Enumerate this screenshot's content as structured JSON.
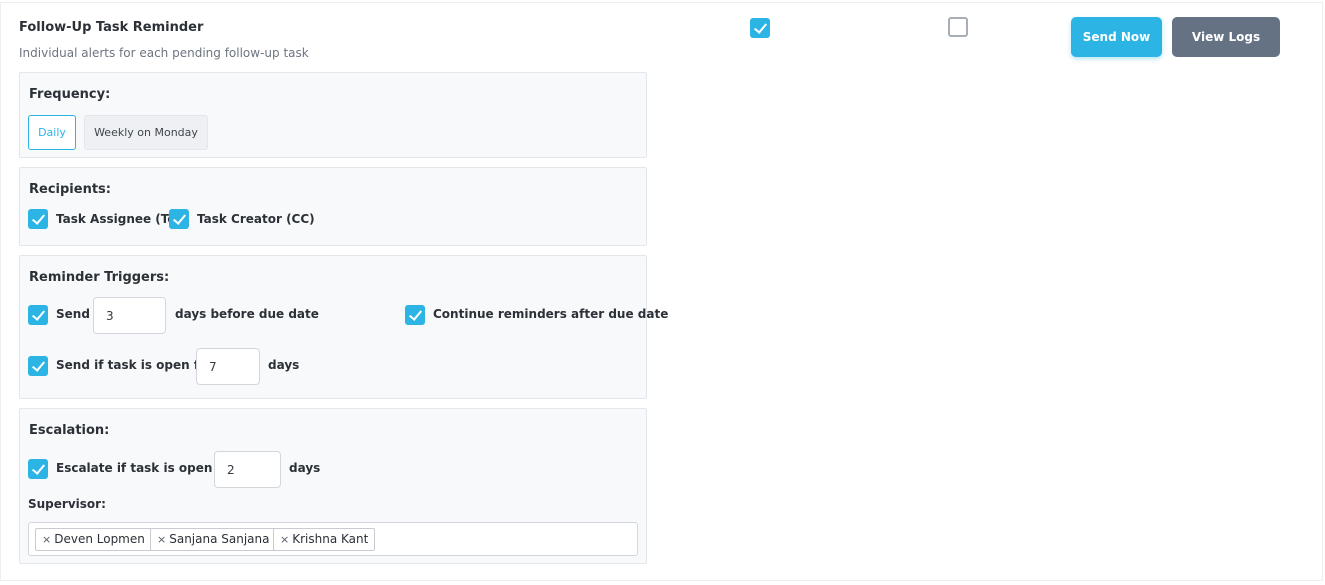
{
  "header": {
    "title": "Follow-Up Task Reminder",
    "subtitle": "Individual alerts for each pending follow-up task",
    "enabled_checkbox": true,
    "second_checkbox": false,
    "send_now_label": "Send Now",
    "view_logs_label": "View Logs"
  },
  "frequency": {
    "label": "Frequency:",
    "options": [
      "Daily",
      "Weekly on Monday"
    ],
    "selected": "Daily"
  },
  "recipients": {
    "label": "Recipients:",
    "items": [
      {
        "label": "Task Assignee (To)",
        "checked": true
      },
      {
        "label": "Task Creator (CC)",
        "checked": true
      }
    ]
  },
  "triggers": {
    "label": "Reminder Triggers:",
    "before_due": {
      "checked": true,
      "prefix": "Send",
      "value": "3",
      "suffix": "days before due date"
    },
    "continue_after": {
      "checked": true,
      "label": "Continue reminders after due date"
    },
    "open_for": {
      "checked": true,
      "prefix": "Send if task is open for",
      "value": "7",
      "suffix": "days"
    }
  },
  "escalation": {
    "label": "Escalation:",
    "open_for": {
      "checked": true,
      "prefix": "Escalate if task is open for",
      "value": "2",
      "suffix": "days"
    },
    "supervisor_label": "Supervisor:",
    "remove_symbol": "×",
    "supervisors": [
      "Deven Lopmen",
      "Sanjana Sanjana",
      "Krishna Kant"
    ]
  },
  "colors": {
    "accent": "#2bb4e4",
    "secondary_button": "#657284"
  }
}
